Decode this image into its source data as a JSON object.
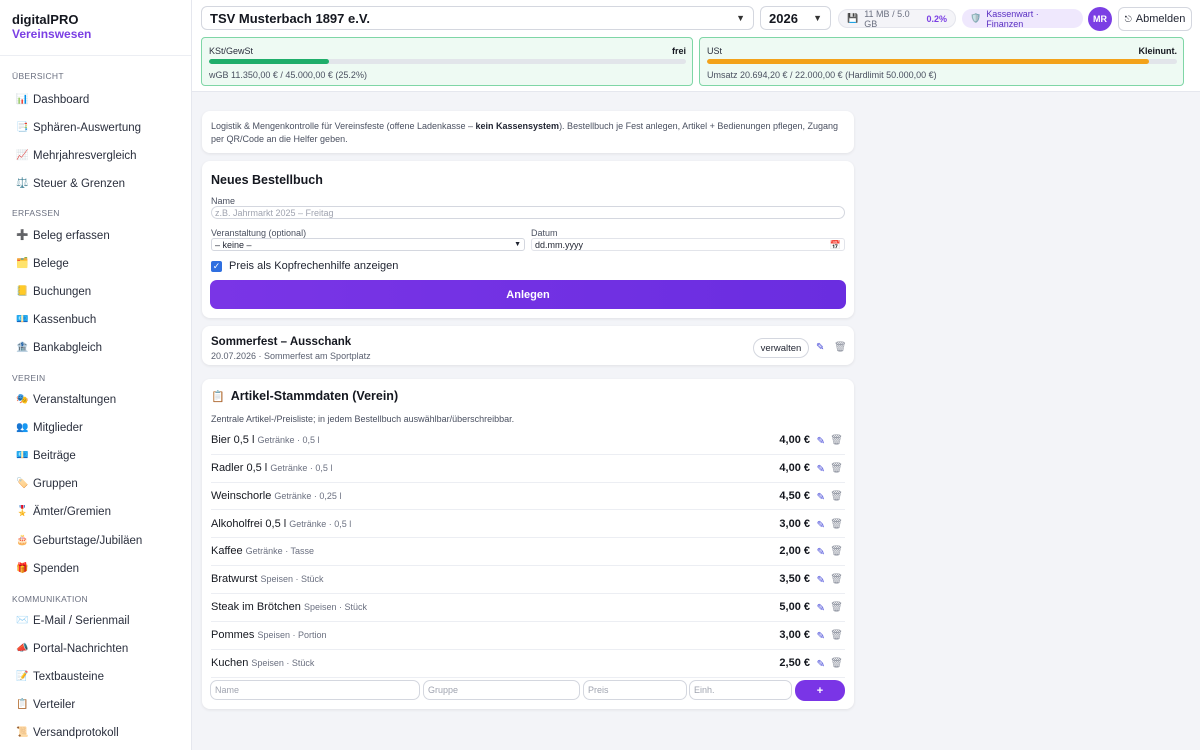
{
  "brand": {
    "title": "digitalPRO",
    "subtitle": "Vereinswesen"
  },
  "sidebar": {
    "sections": [
      {
        "label": "Übersicht",
        "items": [
          {
            "label": "Dashboard",
            "icon": "📊"
          },
          {
            "label": "Sphären-Auswertung",
            "icon": "📑"
          },
          {
            "label": "Mehrjahresvergleich",
            "icon": "📈"
          },
          {
            "label": "Steuer & Grenzen",
            "icon": "⚖️"
          }
        ]
      },
      {
        "label": "Erfassen",
        "items": [
          {
            "label": "Beleg erfassen",
            "icon": "➕"
          },
          {
            "label": "Belege",
            "icon": "🗂️"
          },
          {
            "label": "Buchungen",
            "icon": "📒"
          },
          {
            "label": "Kassenbuch",
            "icon": "💶"
          },
          {
            "label": "Bankabgleich",
            "icon": "🏦"
          }
        ]
      },
      {
        "label": "Verein",
        "items": [
          {
            "label": "Veranstaltungen",
            "icon": "🎭"
          },
          {
            "label": "Mitglieder",
            "icon": "👥"
          },
          {
            "label": "Beiträge",
            "icon": "💶"
          },
          {
            "label": "Gruppen",
            "icon": "🏷️"
          },
          {
            "label": "Ämter/Gremien",
            "icon": "🎖️"
          },
          {
            "label": "Geburtstage/Jubiläen",
            "icon": "🎂"
          },
          {
            "label": "Spenden",
            "icon": "🎁"
          }
        ]
      },
      {
        "label": "Kommunikation",
        "items": [
          {
            "label": "E-Mail / Serienmail",
            "icon": "✉️"
          },
          {
            "label": "Portal-Nachrichten",
            "icon": "📣"
          },
          {
            "label": "Textbausteine",
            "icon": "📝"
          },
          {
            "label": "Verteiler",
            "icon": "📋"
          },
          {
            "label": "Versandprotokoll",
            "icon": "📜"
          }
        ]
      }
    ]
  },
  "topbar": {
    "club": "TSV Musterbach 1897 e.V.",
    "year": "2026",
    "storage": {
      "used": "11 MB / 5.0 GB",
      "percent": "0.2%"
    },
    "role": "Kassenwart · Finanzen",
    "avatar": "MR",
    "logout": "Abmelden"
  },
  "limits": [
    {
      "label": "KSt/GewSt",
      "state": "frei",
      "detail": "wGB 11.350,00 € / 45.000,00 € (25.2%)",
      "fraction": 0.252,
      "color": "#1fae6a"
    },
    {
      "label": "USt",
      "state": "Kleinunt.",
      "detail": "Umsatz 20.694,20 € / 22.000,00 € (Hardlimit 50.000,00 €)",
      "fraction": 0.94,
      "color": "#f3a21a"
    }
  ],
  "intro": {
    "pre": "Logistik & Mengenkontrolle für Vereinsfeste (offene Ladenkasse – ",
    "bold": "kein Kassensystem",
    "post": "). Bestellbuch je Fest anlegen, Artikel + Bedienungen pflegen, Zugang per QR/Code an die Helfer geben."
  },
  "form": {
    "title": "Neues Bestellbuch",
    "name_label": "Name",
    "name_placeholder": "z.B. Jahrmarkt 2025 – Freitag",
    "event_label": "Veranstaltung (optional)",
    "event_value": "– keine –",
    "date_label": "Datum",
    "date_placeholder": "dd.mm.yyyy",
    "checkbox_label": "Preis als Kopfrechenhilfe anzeigen",
    "submit": "Anlegen"
  },
  "book": {
    "title": "Sommerfest – Ausschank",
    "meta": "20.07.2026 · Sommerfest am Sportplatz",
    "manage": "verwalten"
  },
  "articles": {
    "title": "Artikel-Stammdaten (Verein)",
    "subtitle": "Zentrale Artikel-/Preisliste; in jedem Bestellbuch auswählbar/überschreibbar.",
    "items": [
      {
        "name": "Bier 0,5 l",
        "meta": "Getränke · 0,5 l",
        "price": "4,00 €"
      },
      {
        "name": "Radler 0,5 l",
        "meta": "Getränke · 0,5 l",
        "price": "4,00 €"
      },
      {
        "name": "Weinschorle",
        "meta": "Getränke · 0,25 l",
        "price": "4,50 €"
      },
      {
        "name": "Alkoholfrei 0,5 l",
        "meta": "Getränke · 0,5 l",
        "price": "3,00 €"
      },
      {
        "name": "Kaffee",
        "meta": "Getränke · Tasse",
        "price": "2,00 €"
      },
      {
        "name": "Bratwurst",
        "meta": "Speisen · Stück",
        "price": "3,50 €"
      },
      {
        "name": "Steak im Brötchen",
        "meta": "Speisen · Stück",
        "price": "5,00 €"
      },
      {
        "name": "Pommes",
        "meta": "Speisen · Portion",
        "price": "3,00 €"
      },
      {
        "name": "Kuchen",
        "meta": "Speisen · Stück",
        "price": "2,50 €"
      }
    ],
    "add": {
      "name_ph": "Name",
      "group_ph": "Gruppe",
      "price_ph": "Preis",
      "unit_ph": "Einh.",
      "button": "+"
    }
  }
}
